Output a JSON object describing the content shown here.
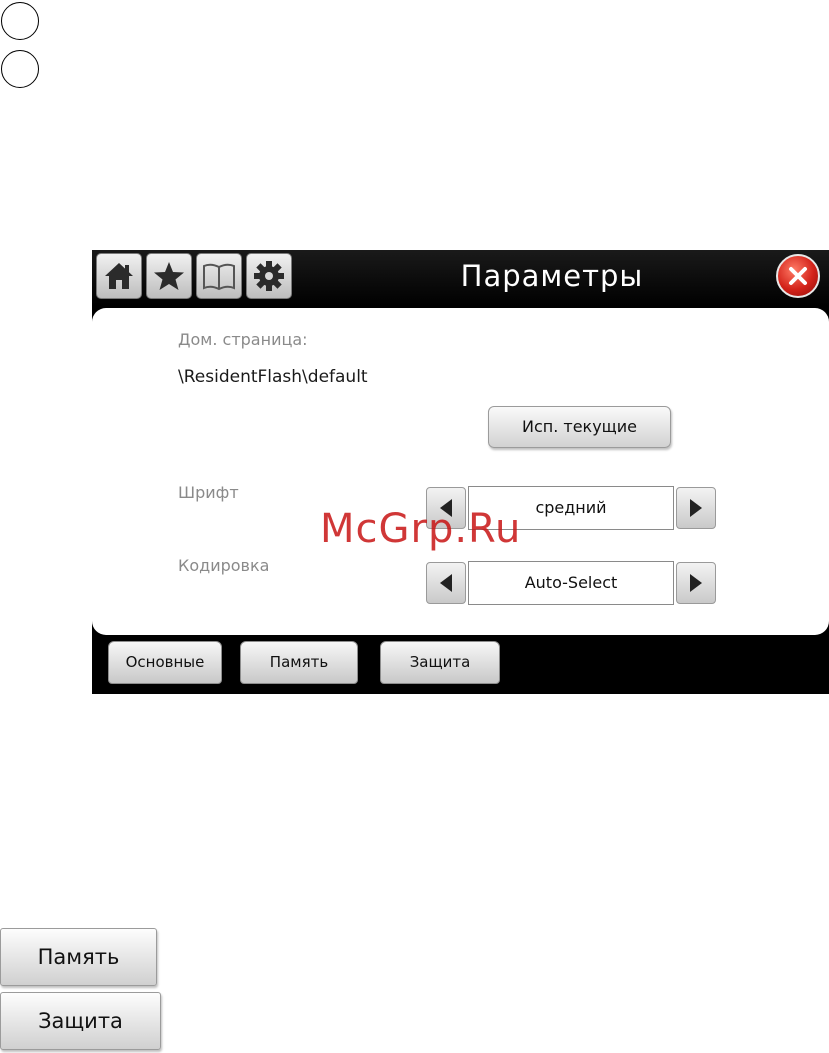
{
  "window": {
    "title": "Параметры",
    "icons": [
      "home-icon",
      "star-icon",
      "book-icon",
      "gear-icon"
    ],
    "close_icon": "close-icon"
  },
  "panel": {
    "home_label": "Дом. страница:",
    "home_value": "\\ResidentFlash\\default",
    "use_current_label": "Исп. текущие",
    "font": {
      "label": "Шрифт",
      "value": "средний"
    },
    "encoding": {
      "label": "Кодировка",
      "value": "Auto-Select"
    }
  },
  "tabs": [
    {
      "label": "Основные"
    },
    {
      "label": "Память"
    },
    {
      "label": "Защита"
    }
  ],
  "watermark": "McGrp.Ru",
  "standalone_buttons": {
    "memory": "Память",
    "security": "Защита"
  },
  "colors": {
    "close_red": "#d3231a",
    "watermark_red": "#c81414"
  }
}
